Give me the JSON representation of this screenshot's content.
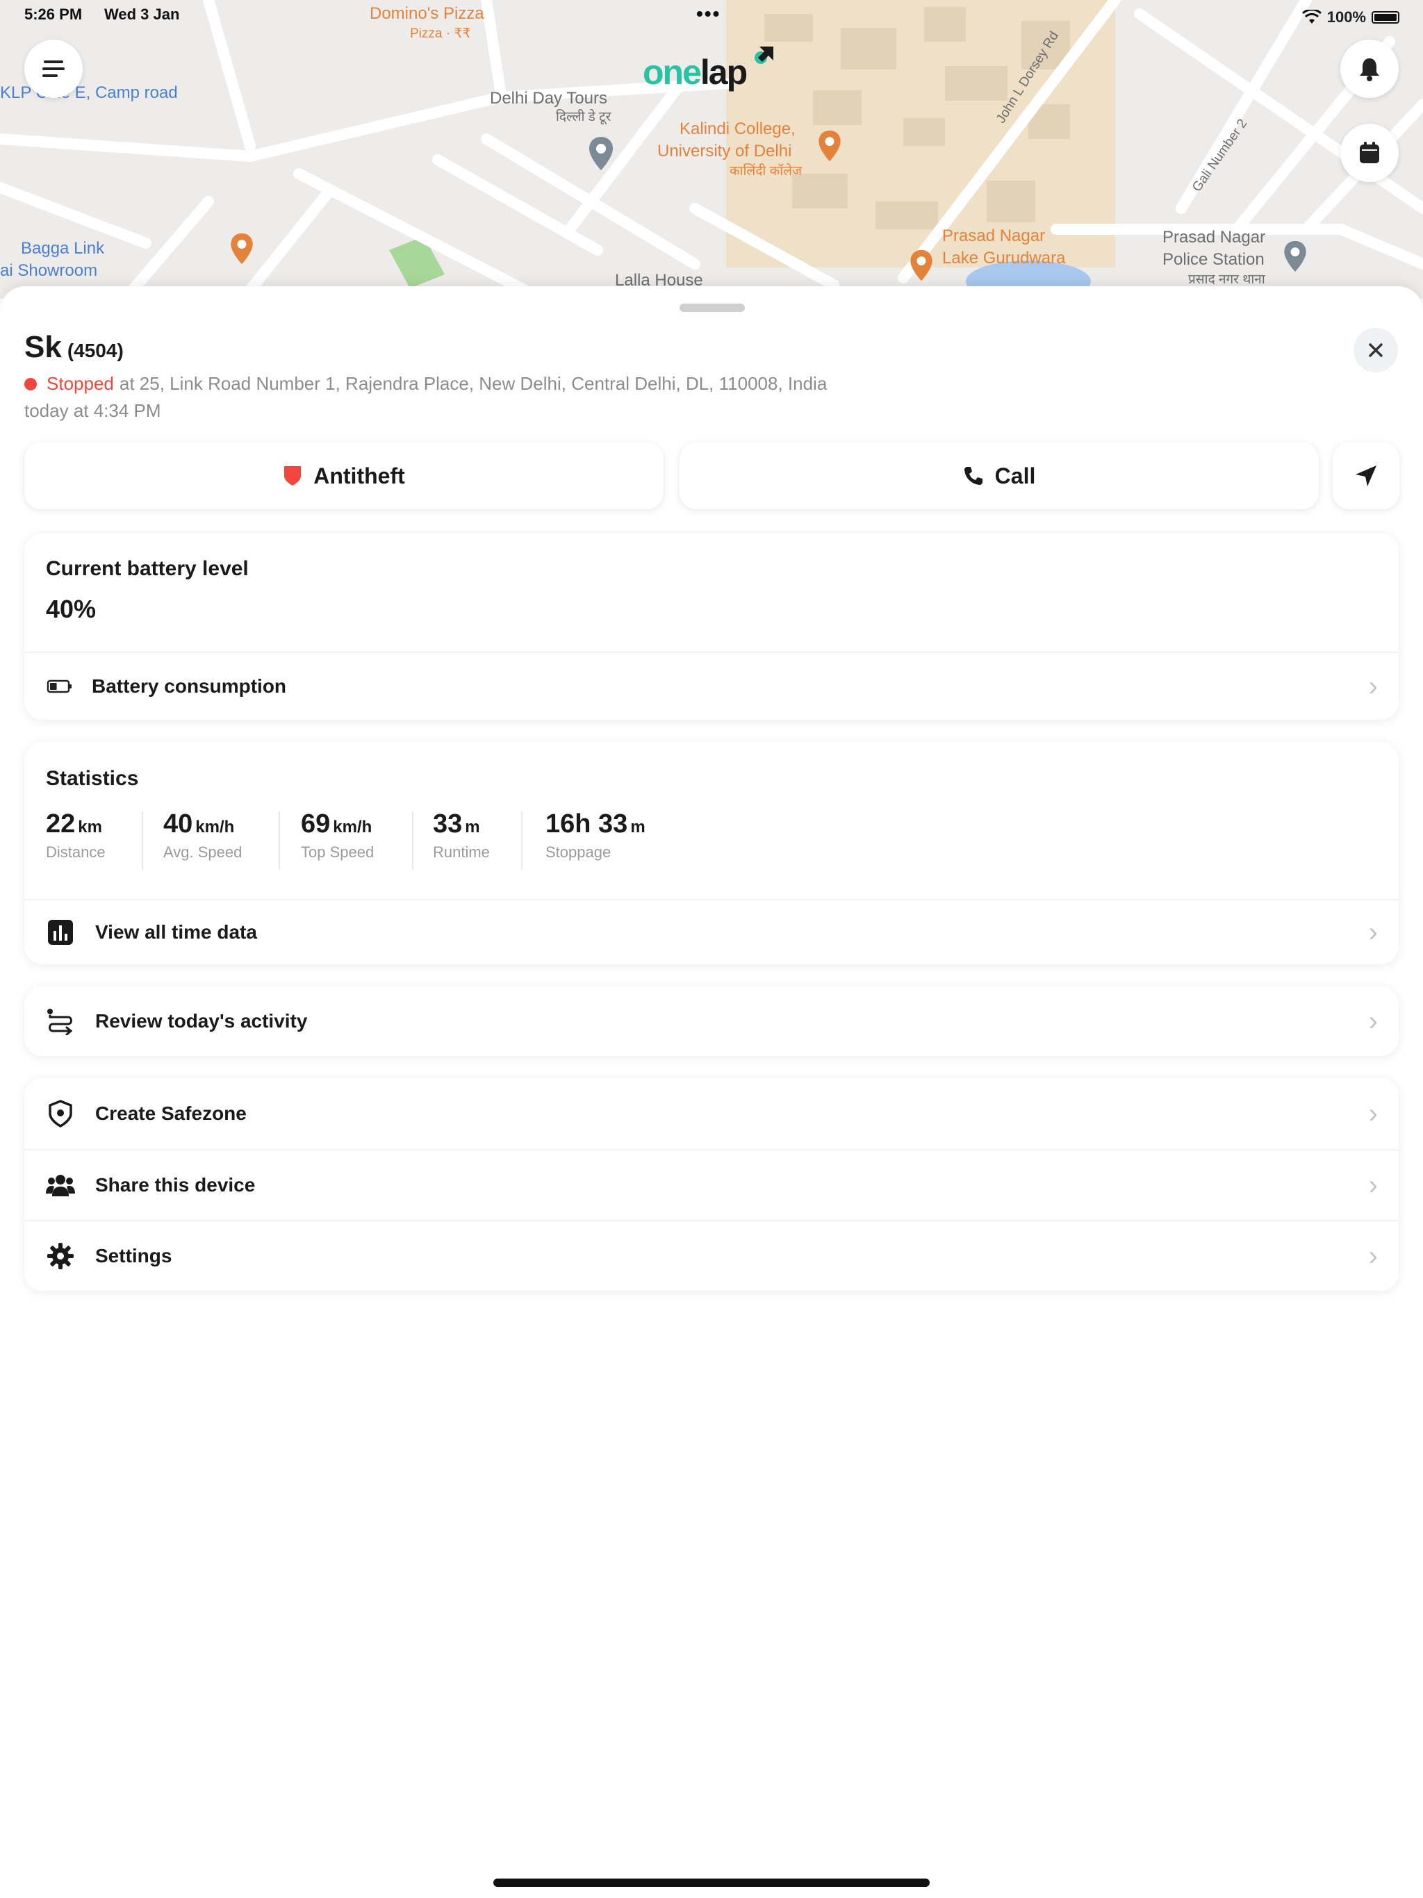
{
  "status_bar": {
    "time": "5:26 PM",
    "date": "Wed 3 Jan",
    "battery": "100%"
  },
  "logo": {
    "part1": "one",
    "part2": "lap"
  },
  "map_labels": {
    "dominos": "Domino's Pizza",
    "dominos_sub": "Pizza · ₹₹",
    "camp_road": "KLP Cine E, Camp road",
    "delhi_day_tours": "Delhi Day Tours",
    "delhi_day_tours_sub": "दिल्ली डे टूर",
    "kalindi": "Kalindi College,",
    "kalindi2": "University of Delhi",
    "kalindi_sub": "कालिंदी कॉलेज",
    "john_road": "John L Dorsey Rd",
    "gali": "Gali Number 2",
    "bagga1": "Bagga Link",
    "bagga2": "ai Showroom",
    "lalla_house": "Lalla House",
    "prasad1": "Prasad Nagar",
    "prasad2": "Lake Gurudwara",
    "police1": "Prasad Nagar",
    "police2": "Police Station",
    "police_sub": "प्रसाद नगर थाना"
  },
  "device": {
    "name": "Sk",
    "id": "(4504)",
    "status": "Stopped",
    "address": "at 25, Link Road Number 1, Rajendra Place, New Delhi, Central Delhi, DL, 110008, India",
    "time": "today at 4:34 PM"
  },
  "actions": {
    "antitheft": "Antitheft",
    "call": "Call"
  },
  "battery_card": {
    "title": "Current battery level",
    "value": "40%",
    "level_fraction": 0.4,
    "consumption_label": "Battery consumption"
  },
  "statistics": {
    "title": "Statistics",
    "items": [
      {
        "value": "22",
        "unit": "km",
        "label": "Distance"
      },
      {
        "value": "40",
        "unit": "km/h",
        "label": "Avg. Speed"
      },
      {
        "value": "69",
        "unit": "km/h",
        "label": "Top Speed"
      },
      {
        "value": "33",
        "unit": "m",
        "label": "Runtime"
      },
      {
        "value": "16h 33",
        "unit": "m",
        "label": "Stoppage"
      }
    ],
    "view_all_label": "View all time data"
  },
  "review_label": "Review today's activity",
  "menu": {
    "safezone": "Create Safezone",
    "share": "Share this device",
    "settings": "Settings"
  },
  "colors": {
    "accent_green": "#2bc2a4",
    "stopped_red": "#f2453d",
    "map_orange": "#e3823a",
    "map_blue": "#4a7fd1"
  }
}
